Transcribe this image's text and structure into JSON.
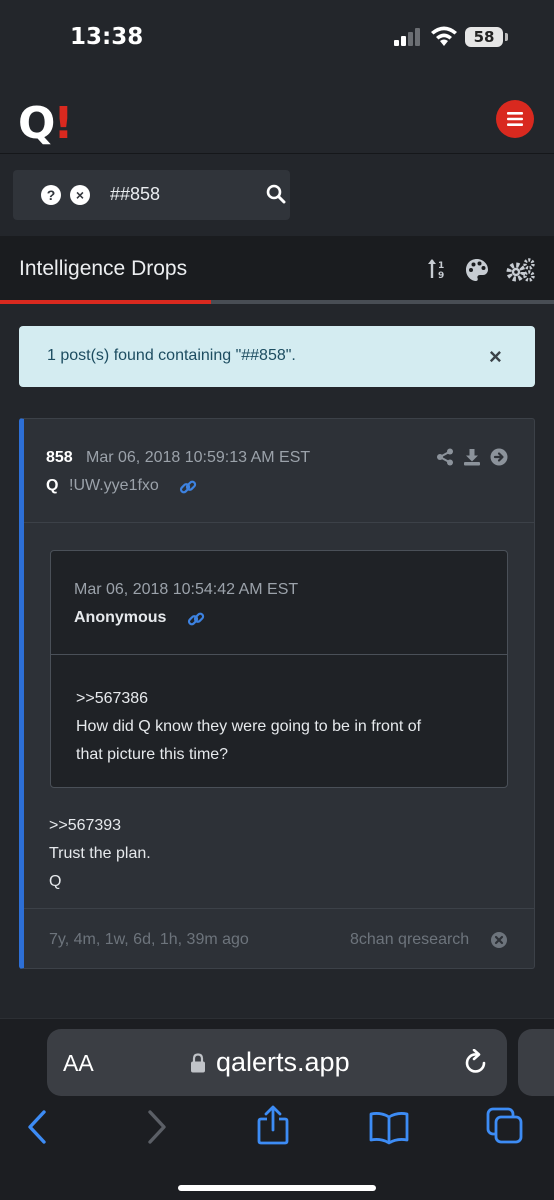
{
  "status_bar": {
    "time": "13:38",
    "battery": "58"
  },
  "app": {
    "logo": "Q",
    "logo_accent": "!"
  },
  "search": {
    "query": "##858"
  },
  "section": {
    "title": "Intelligence Drops",
    "progress": 0.38
  },
  "alert": {
    "message": "1 post(s) found containing \"##858\".",
    "close": "×"
  },
  "post": {
    "number": "858",
    "date": "Mar 06, 2018 10:59:13 AM EST",
    "author": "Q",
    "tripcode": "!UW.yye1fxo",
    "quote": {
      "date": "Mar 06, 2018 10:54:42 AM EST",
      "author": "Anonymous",
      "lines": [
        ">>567386",
        "How did Q know they were going to be in front of",
        "that picture this time?"
      ]
    },
    "body_lines": [
      ">>567393",
      "Trust the plan.",
      "Q"
    ],
    "age": "7y, 4m, 1w, 6d, 1h, 39m ago",
    "source": "8chan qresearch"
  },
  "browser": {
    "text_size": "AA",
    "domain": "qalerts.app"
  },
  "colors": {
    "accent_red": "#d9291f",
    "accent_blue": "#2d6fd6",
    "alert_bg": "#d4ecf1"
  }
}
